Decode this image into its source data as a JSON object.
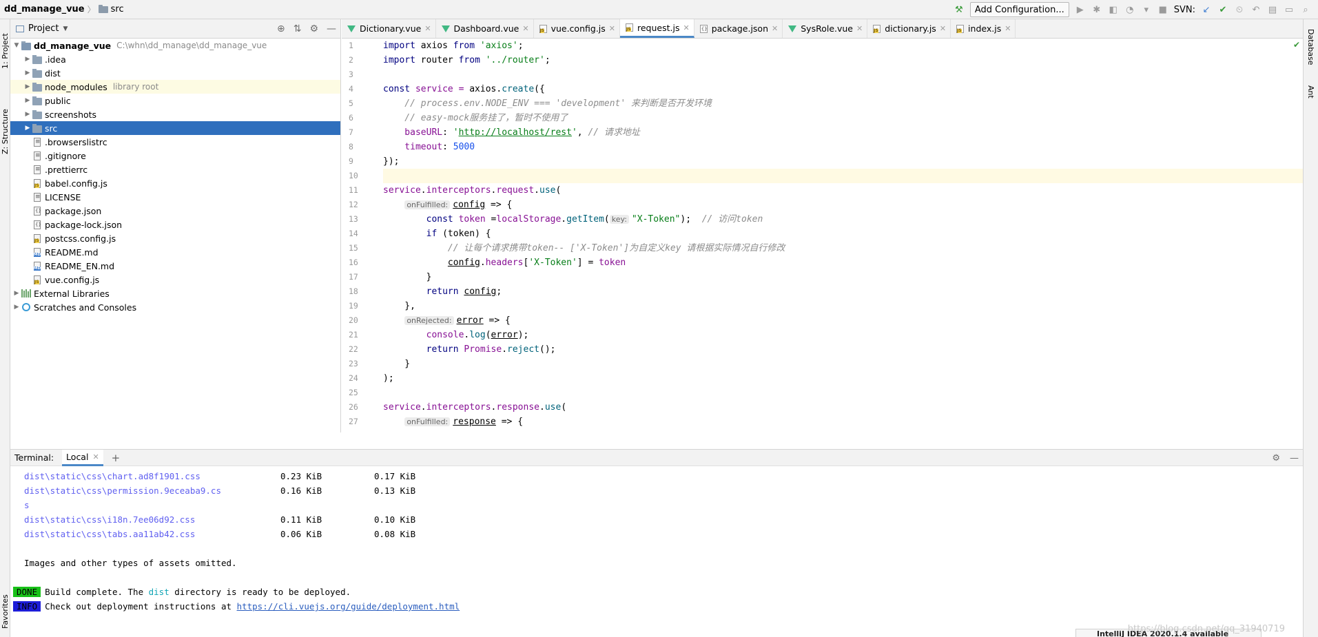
{
  "breadcrumb": {
    "project": "dd_manage_vue",
    "folder": "src"
  },
  "toolbar": {
    "add_configuration": "Add Configuration...",
    "svn_label": "SVN:"
  },
  "left_strip": {
    "project_tab": "1: Project",
    "structure_tab": "Z: Structure",
    "favorites_tab": "Favorites"
  },
  "right_strip": {
    "database_tab": "Database",
    "ant_tab": "Ant"
  },
  "project_panel": {
    "title": "Project",
    "root": {
      "name": "dd_manage_vue",
      "path": "C:\\whn\\dd_manage\\dd_manage_vue"
    },
    "items": [
      {
        "label": ".idea",
        "type": "folder"
      },
      {
        "label": "dist",
        "type": "folder"
      },
      {
        "label": "node_modules",
        "type": "folder",
        "note": "library root"
      },
      {
        "label": "public",
        "type": "folder"
      },
      {
        "label": "screenshots",
        "type": "folder"
      },
      {
        "label": "src",
        "type": "folder",
        "selected": true
      },
      {
        "label": ".browserslistrc",
        "type": "txt"
      },
      {
        "label": ".gitignore",
        "type": "txt"
      },
      {
        "label": ".prettierrc",
        "type": "txt"
      },
      {
        "label": "babel.config.js",
        "type": "js"
      },
      {
        "label": "LICENSE",
        "type": "txt"
      },
      {
        "label": "package.json",
        "type": "json"
      },
      {
        "label": "package-lock.json",
        "type": "json"
      },
      {
        "label": "postcss.config.js",
        "type": "js"
      },
      {
        "label": "README.md",
        "type": "md"
      },
      {
        "label": "README_EN.md",
        "type": "md"
      },
      {
        "label": "vue.config.js",
        "type": "js"
      }
    ],
    "external_libraries": "External Libraries",
    "scratches": "Scratches and Consoles"
  },
  "editor_tabs": [
    {
      "label": "Dictionary.vue",
      "type": "vue"
    },
    {
      "label": "Dashboard.vue",
      "type": "vue"
    },
    {
      "label": "vue.config.js",
      "type": "js"
    },
    {
      "label": "request.js",
      "type": "js",
      "active": true
    },
    {
      "label": "package.json",
      "type": "json"
    },
    {
      "label": "SysRole.vue",
      "type": "vue"
    },
    {
      "label": "dictionary.js",
      "type": "js"
    },
    {
      "label": "index.js",
      "type": "js"
    }
  ],
  "line_numbers": [
    "1",
    "2",
    "3",
    "4",
    "5",
    "6",
    "7",
    "8",
    "9",
    "10",
    "11",
    "12",
    "13",
    "14",
    "15",
    "16",
    "17",
    "18",
    "19",
    "20",
    "21",
    "22",
    "23",
    "24",
    "25",
    "26",
    "27"
  ],
  "code": {
    "l1_kw": "import",
    "l1_a": " axios ",
    "l1_from": "from",
    "l1_str": " 'axios'",
    "l1_end": ";",
    "l2_kw": "import",
    "l2_a": " router ",
    "l2_from": "from",
    "l2_str": " '../router'",
    "l2_end": ";",
    "l4_kw": "const",
    "l4_a": " service = ",
    "l4_b": "axios",
    "l4_c": ".",
    "l4_fn": "create",
    "l4_end": "({",
    "l5": "    // process.env.NODE_ENV === 'development' 来判断是否开发环境",
    "l6": "    // easy-mock服务挂了，暂时不使用了",
    "l7_prop": "    baseURL",
    "l7_a": ": ",
    "l7_str1": "'",
    "l7_url": "http://localhost/rest",
    "l7_str2": "'",
    "l7_b": ", ",
    "l7_cm": "// 请求地址",
    "l8_prop": "    timeout",
    "l8_a": ": ",
    "l8_num": "5000",
    "l9": "});",
    "l11_a": "service",
    "l11_b": ".",
    "l11_p1": "interceptors",
    "l11_c": ".",
    "l11_p2": "request",
    "l11_d": ".",
    "l11_fn": "use",
    "l11_e": "(",
    "l12_hint": "onFulfilled:",
    "l12_p": "config",
    "l12_e": " => {",
    "l13_kw": "        const",
    "l13_v": " token ",
    "l13_a": "=",
    "l13_p": "localStorage",
    "l13_b": ".",
    "l13_fn": "getItem",
    "l13_c": "(",
    "l13_hint": "key:",
    "l13_str": "\"X-Token\"",
    "l13_d": ");  ",
    "l13_cm": "// 访问token",
    "l14_kw": "        if",
    "l14_a": " (token) {",
    "l15": "            // 让每个请求携带token-- ['X-Token']为自定义key 请根据实际情况自行修改",
    "l16_p": "config",
    "l16_b": ".",
    "l16_p2": "headers",
    "l16_c": "[",
    "l16_str": "'X-Token'",
    "l16_d": "] = ",
    "l16_v": "token",
    "l17": "        }",
    "l18_kw": "        return",
    "l18_p": "config",
    "l18_e": ";",
    "l19": "    },",
    "l20_hint": "onRejected:",
    "l20_p": "error",
    "l20_e": " => {",
    "l21_p": "        console",
    "l21_b": ".",
    "l21_fn": "log",
    "l21_c": "(",
    "l21_v": "error",
    "l21_d": ");",
    "l22_kw": "        return",
    "l22_p": " Promise",
    "l22_b": ".",
    "l22_fn": "reject",
    "l22_c": "();",
    "l23": "    }",
    "l24": ");",
    "l26_a": "service",
    "l26_b": ".",
    "l26_p1": "interceptors",
    "l26_c": ".",
    "l26_p2": "response",
    "l26_d": ".",
    "l26_fn": "use",
    "l26_e": "(",
    "l27_hint": "onFulfilled:",
    "l27_p": "response",
    "l27_e": " => {"
  },
  "terminal": {
    "label": "Terminal:",
    "tab": "Local",
    "rows": [
      {
        "path": "dist\\static\\css\\chart.ad8f1901.css",
        "size1": "0.23 KiB",
        "size2": "0.17 KiB"
      },
      {
        "path": "dist\\static\\css\\permission.9eceaba9.cs",
        "size1": "0.16 KiB",
        "size2": "0.13 KiB"
      },
      {
        "path": "s",
        "size1": "",
        "size2": ""
      },
      {
        "path": "dist\\static\\css\\i18n.7ee06d92.css",
        "size1": "0.11 KiB",
        "size2": "0.10 KiB"
      },
      {
        "path": "dist\\static\\css\\tabs.aa11ab42.css",
        "size1": "0.06 KiB",
        "size2": "0.08 KiB"
      }
    ],
    "assets_omitted": "Images and other types of assets omitted.",
    "done_badge": "DONE",
    "done_a": "Build complete. The ",
    "done_dist": "dist",
    "done_b": " directory is ready to be deployed.",
    "info_badge": "INFO",
    "info_a": "Check out deployment instructions at ",
    "info_link": "https://cli.vuejs.org/guide/deployment.html"
  },
  "watermark": "https://blog.csdn.net/qq_31940719",
  "notification": "IntelliJ IDEA 2020.1.4 available"
}
